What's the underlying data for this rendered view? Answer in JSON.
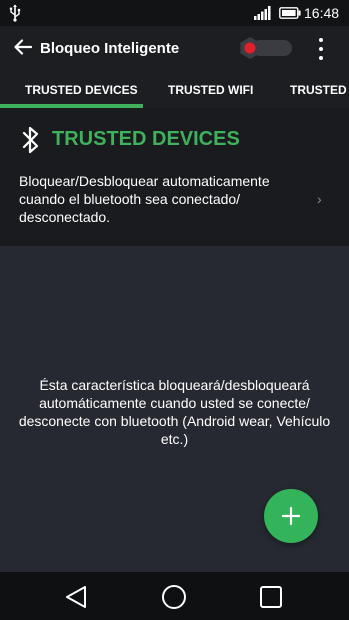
{
  "status_bar": {
    "time": "16:48",
    "icons": [
      "usb-icon",
      "signal-icon",
      "battery-icon"
    ]
  },
  "toolbar": {
    "back_icon": "arrow-left-icon",
    "title": "Bloqueo Inteligente",
    "toggle_state": "off",
    "menu_icon": "more-vert-icon"
  },
  "tabs": [
    {
      "label": "TRUSTED DEVICES",
      "selected": true
    },
    {
      "label": "TRUSTED WIFI",
      "selected": false
    },
    {
      "label": "TRUSTED L",
      "selected": false
    }
  ],
  "section": {
    "icon": "bluetooth-icon",
    "title": "TRUSTED DEVICES",
    "description": "Bloquear/Desbloquear automaticamente cuando el bluetooth sea conectado/ desconectado.",
    "chevron": "›"
  },
  "empty_state": {
    "message": "Ésta característica bloqueará/desbloqueará automáticamente cuando usted se conecte/ desconecte con bluetooth (Android wear, Vehículo etc.)"
  },
  "fab": {
    "icon": "plus-icon"
  },
  "navbar": {
    "icons": [
      "back-triangle-icon",
      "home-circle-icon",
      "recents-square-icon"
    ]
  },
  "colors": {
    "accent": "#3fb05b",
    "fab": "#33b35a",
    "toggle_knob": "#e0202d",
    "background": "#1c1e22",
    "content_bg": "#262931"
  }
}
